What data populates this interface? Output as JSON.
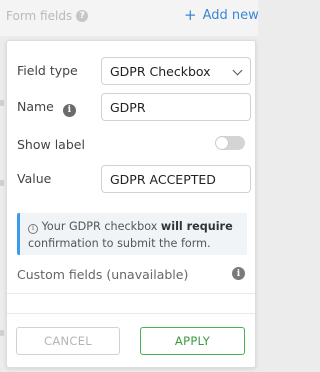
{
  "background": {
    "title": "Form fields",
    "help_icon": "?",
    "add_new_label": "Add new",
    "add_new_icon": "+"
  },
  "panel": {
    "field_type": {
      "label": "Field type",
      "value": "GDPR Checkbox"
    },
    "name": {
      "label": "Name",
      "info_icon": "i",
      "value": "GDPR"
    },
    "show_label": {
      "label": "Show label",
      "enabled": false
    },
    "value_field": {
      "label": "Value",
      "value": "GDPR ACCEPTED"
    },
    "note": {
      "icon": "i",
      "text_before": "Your GDPR checkbox",
      "text_bold": "will require",
      "text_after": "confirmation to submit the form."
    },
    "custom_fields": {
      "label": "Custom fields (unavailable)",
      "info_icon": "i"
    },
    "buttons": {
      "cancel": "CANCEL",
      "apply": "APPLY"
    }
  },
  "colors": {
    "accent_blue": "#3a86d6",
    "note_border": "#3d9be9",
    "apply_green": "#4caf50"
  }
}
